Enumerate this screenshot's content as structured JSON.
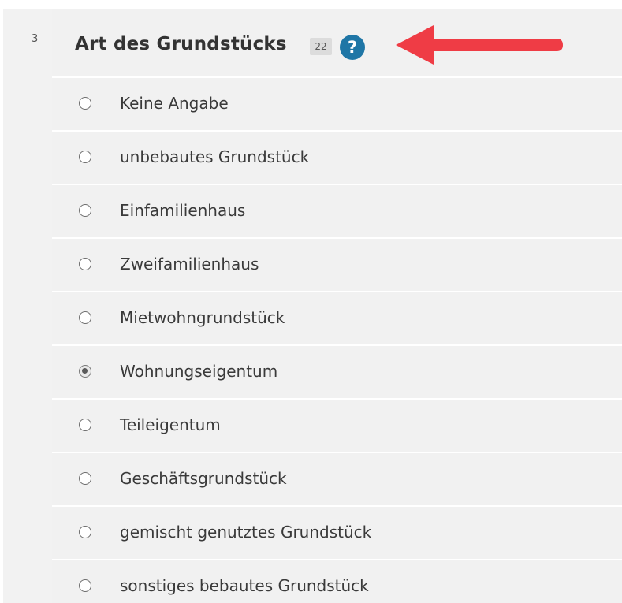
{
  "question": {
    "number": "3",
    "title": "Art des Grundstücks",
    "badge": "22",
    "help_glyph": "?"
  },
  "colors": {
    "panel_background": "#f1f1f1",
    "help_icon": "#1f76a6",
    "annotation_arrow": "#ef3c45"
  },
  "icons": {
    "help": "question-circle-icon",
    "annotation": "arrow-left-icon"
  },
  "options": [
    {
      "label": "Keine Angabe",
      "selected": false
    },
    {
      "label": "unbebautes Grundstück",
      "selected": false
    },
    {
      "label": "Einfamilienhaus",
      "selected": false
    },
    {
      "label": "Zweifamilienhaus",
      "selected": false
    },
    {
      "label": "Mietwohngrundstück",
      "selected": false
    },
    {
      "label": "Wohnungseigentum",
      "selected": true
    },
    {
      "label": "Teileigentum",
      "selected": false
    },
    {
      "label": "Geschäftsgrundstück",
      "selected": false
    },
    {
      "label": "gemischt genutztes Grundstück",
      "selected": false
    },
    {
      "label": "sonstiges bebautes Grundstück",
      "selected": false
    }
  ]
}
